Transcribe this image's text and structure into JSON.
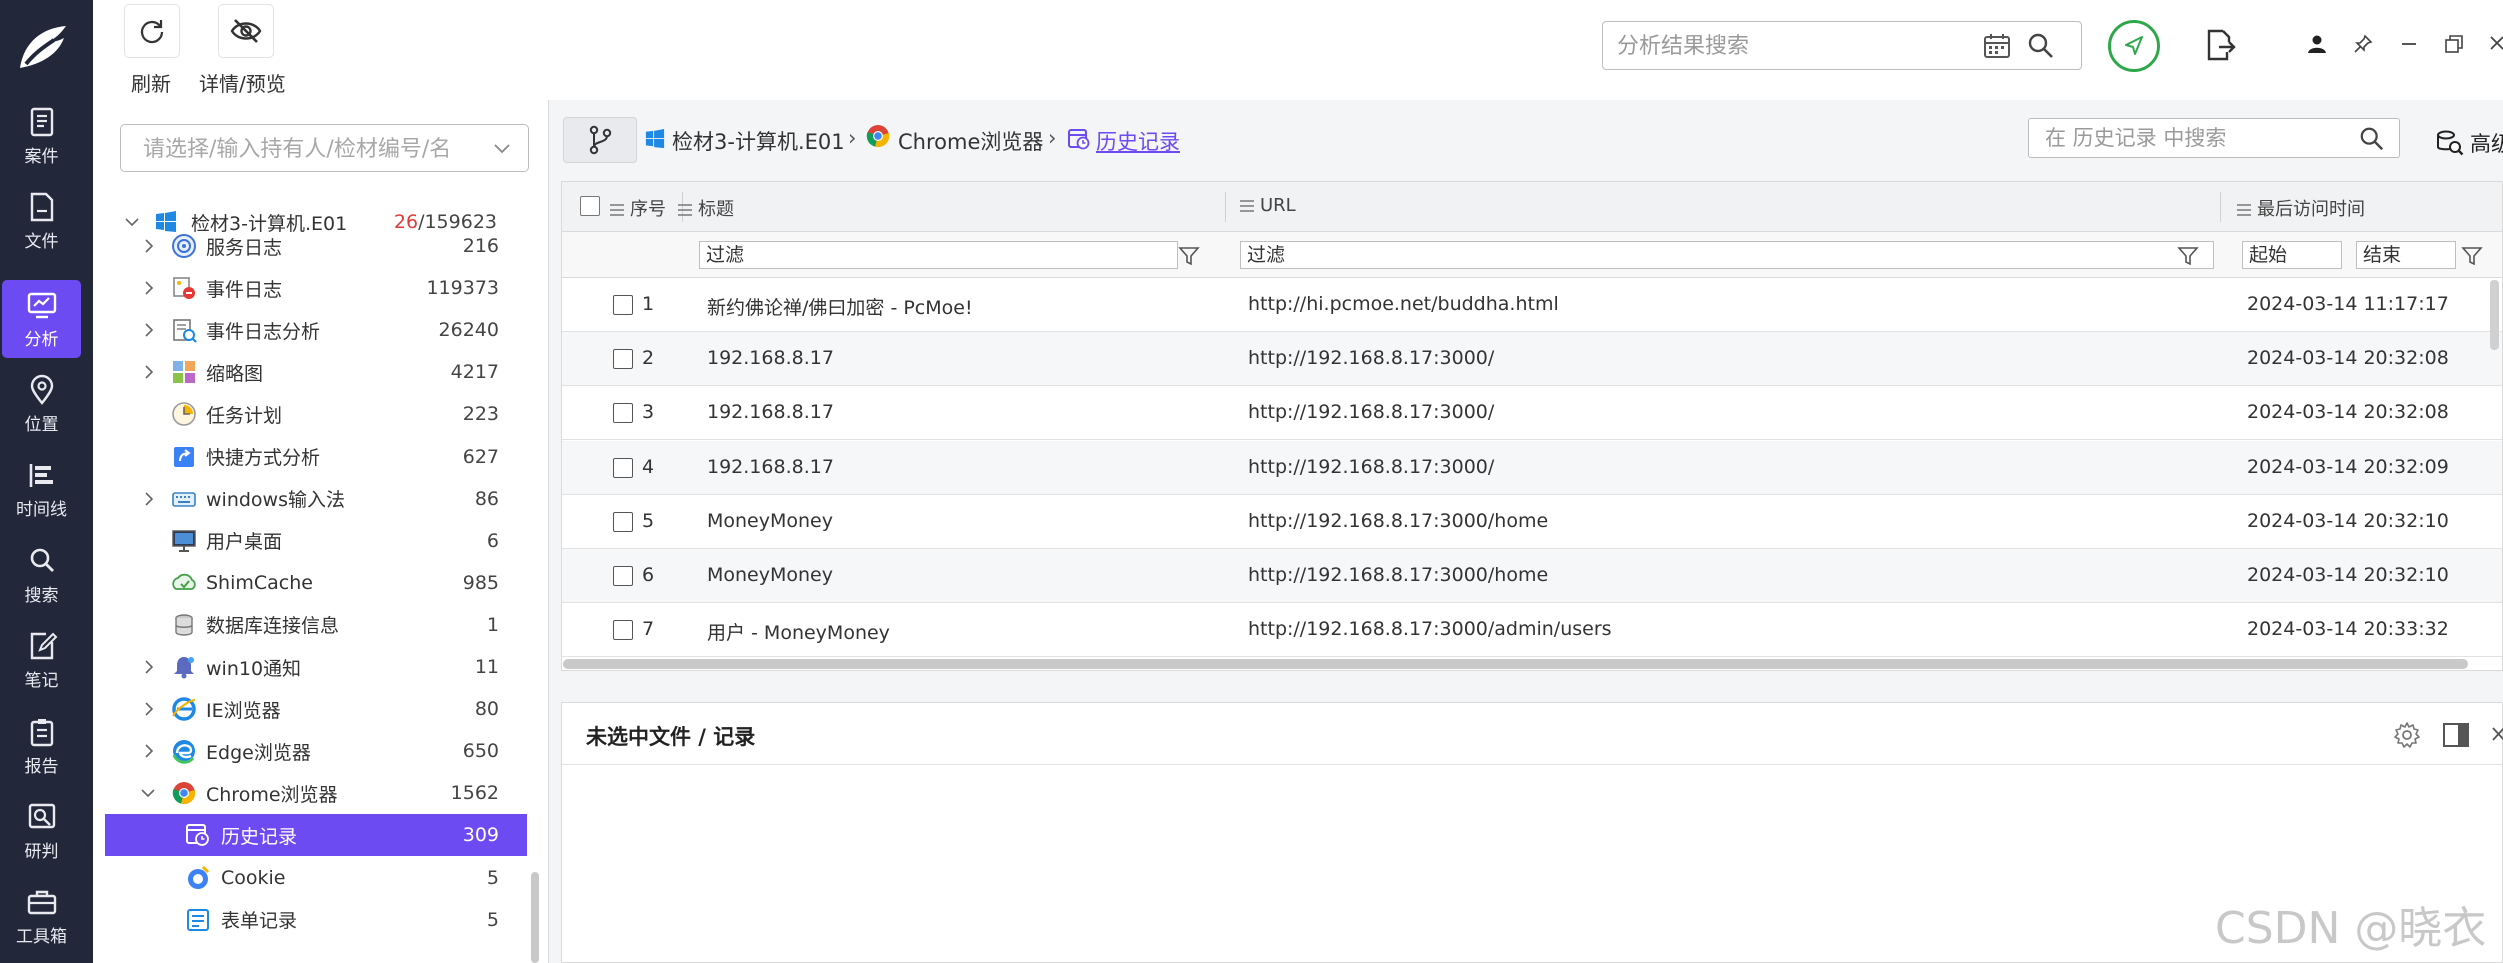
{
  "nav": {
    "items": [
      {
        "label": "案件",
        "icon": "case-icon"
      },
      {
        "label": "文件",
        "icon": "file-icon"
      },
      {
        "label": "分析",
        "icon": "analysis-icon",
        "active": true
      },
      {
        "label": "位置",
        "icon": "location-icon"
      },
      {
        "label": "时间线",
        "icon": "timeline-icon"
      },
      {
        "label": "搜索",
        "icon": "search-icon"
      },
      {
        "label": "笔记",
        "icon": "note-icon"
      },
      {
        "label": "报告",
        "icon": "report-icon"
      },
      {
        "label": "研判",
        "icon": "judge-icon"
      },
      {
        "label": "工具箱",
        "icon": "toolbox-icon"
      }
    ]
  },
  "toolbar": {
    "refresh_label": "刷新",
    "details_label": "详情/预览",
    "search_placeholder": "分析结果搜索"
  },
  "tree": {
    "owner_placeholder": "请选择/输入持有人/检材编号/名",
    "root": {
      "label": "检材3-计算机.E01",
      "count_highlight": "26",
      "count_total": "/159623"
    },
    "items": [
      {
        "label": "服务日志",
        "count": "216",
        "icon": "service-log-icon",
        "expandable": true
      },
      {
        "label": "事件日志",
        "count": "119373",
        "icon": "event-log-icon",
        "expandable": true
      },
      {
        "label": "事件日志分析",
        "count": "26240",
        "icon": "event-analysis-icon",
        "expandable": true
      },
      {
        "label": "缩略图",
        "count": "4217",
        "icon": "thumbnail-icon",
        "expandable": true
      },
      {
        "label": "任务计划",
        "count": "223",
        "icon": "task-schedule-icon",
        "expandable": false
      },
      {
        "label": "快捷方式分析",
        "count": "627",
        "icon": "shortcut-icon",
        "expandable": false
      },
      {
        "label": "windows输入法",
        "count": "86",
        "icon": "keyboard-icon",
        "expandable": true
      },
      {
        "label": "用户桌面",
        "count": "6",
        "icon": "desktop-icon",
        "expandable": false
      },
      {
        "label": "ShimCache",
        "count": "985",
        "icon": "shimcache-icon",
        "expandable": false
      },
      {
        "label": "数据库连接信息",
        "count": "1",
        "icon": "database-icon",
        "expandable": false
      },
      {
        "label": "win10通知",
        "count": "11",
        "icon": "notification-icon",
        "expandable": true
      },
      {
        "label": "IE浏览器",
        "count": "80",
        "icon": "ie-icon",
        "expandable": true
      },
      {
        "label": "Edge浏览器",
        "count": "650",
        "icon": "edge-icon",
        "expandable": true
      },
      {
        "label": "Chrome浏览器",
        "count": "1562",
        "icon": "chrome-icon",
        "expandable": true,
        "expanded": true
      }
    ],
    "children": [
      {
        "label": "历史记录",
        "count": "309",
        "icon": "history-icon",
        "selected": true
      },
      {
        "label": "Cookie",
        "count": "5",
        "icon": "cookie-icon"
      },
      {
        "label": "表单记录",
        "count": "5",
        "icon": "form-icon"
      }
    ]
  },
  "breadcrumb": {
    "items": [
      "检材3-计算机.E01",
      "Chrome浏览器",
      "历史记录"
    ]
  },
  "history_search": {
    "placeholder": "在 历史记录 中搜索",
    "advanced_label": "高级"
  },
  "table": {
    "columns": [
      "序号",
      "标题",
      "URL",
      "最后访问时间"
    ],
    "filter_placeholder": "过滤",
    "time_start": "起始",
    "time_end": "结束",
    "rows": [
      {
        "no": "1",
        "title": "新约佛论禅/佛曰加密 - PcMoe!",
        "url": "http://hi.pcmoe.net/buddha.html",
        "time": "2024-03-14 11:17:17"
      },
      {
        "no": "2",
        "title": "192.168.8.17",
        "url": "http://192.168.8.17:3000/",
        "time": "2024-03-14 20:32:08"
      },
      {
        "no": "3",
        "title": "192.168.8.17",
        "url": "http://192.168.8.17:3000/",
        "time": "2024-03-14 20:32:08"
      },
      {
        "no": "4",
        "title": "192.168.8.17",
        "url": "http://192.168.8.17:3000/",
        "time": "2024-03-14 20:32:09"
      },
      {
        "no": "5",
        "title": "MoneyMoney",
        "url": "http://192.168.8.17:3000/home",
        "time": "2024-03-14 20:32:10"
      },
      {
        "no": "6",
        "title": "MoneyMoney",
        "url": "http://192.168.8.17:3000/home",
        "time": "2024-03-14 20:32:10"
      },
      {
        "no": "7",
        "title": "用户 - MoneyMoney",
        "url": "http://192.168.8.17:3000/admin/users",
        "time": "2024-03-14 20:33:32"
      }
    ]
  },
  "detail": {
    "title": "未选中文件 / 记录"
  },
  "watermark": "CSDN @晓衣",
  "colors": {
    "accent": "#6c4bf2",
    "nav_bg": "#22273a",
    "count_red": "#e03b3b",
    "green": "#2ea84a"
  }
}
